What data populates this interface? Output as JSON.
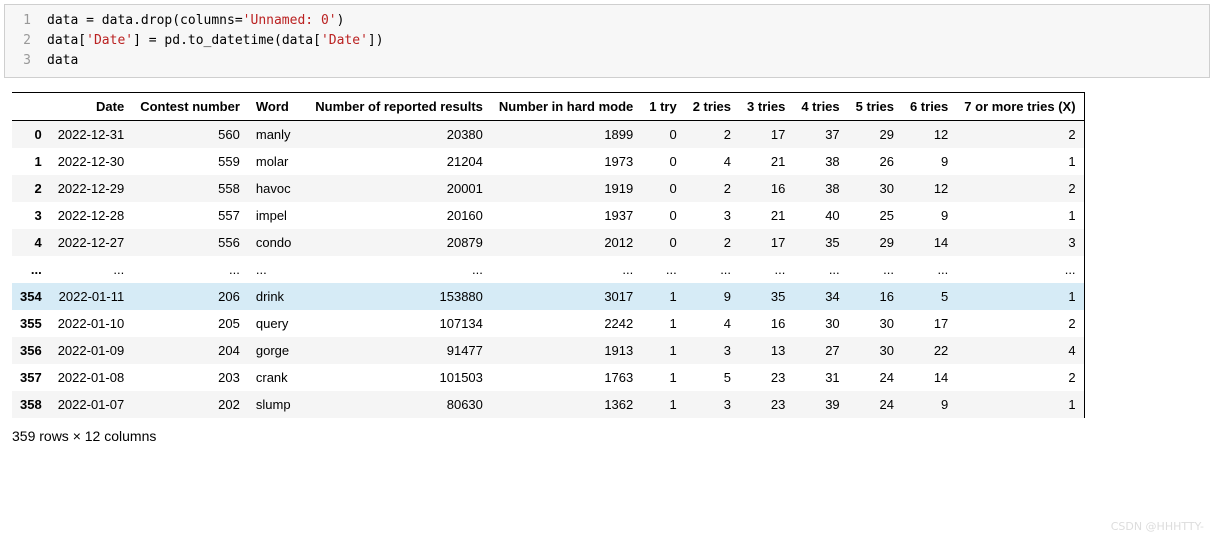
{
  "code": {
    "lines": [
      {
        "n": "1",
        "html": "data = data.drop(columns=<span class=\"tok-str\">'Unnamed: 0'</span>)"
      },
      {
        "n": "2",
        "html": "data[<span class=\"tok-str\">'Date'</span>] = pd.to_datetime(data[<span class=\"tok-str\">'Date'</span>])"
      },
      {
        "n": "3",
        "html": "data"
      }
    ]
  },
  "table": {
    "columns": [
      "",
      "Date",
      "Contest number",
      "Word",
      "Number of reported results",
      "Number in hard mode",
      "1 try",
      "2 tries",
      "3 tries",
      "4 tries",
      "5 tries",
      "6 tries",
      "7 or more tries (X)"
    ],
    "rows": [
      {
        "idx": "0",
        "date": "2022-12-31",
        "contest": "560",
        "word": "manly",
        "reported": "20380",
        "hard": "1899",
        "t1": "0",
        "t2": "2",
        "t3": "17",
        "t4": "37",
        "t5": "29",
        "t6": "12",
        "tx": "2"
      },
      {
        "idx": "1",
        "date": "2022-12-30",
        "contest": "559",
        "word": "molar",
        "reported": "21204",
        "hard": "1973",
        "t1": "0",
        "t2": "4",
        "t3": "21",
        "t4": "38",
        "t5": "26",
        "t6": "9",
        "tx": "1"
      },
      {
        "idx": "2",
        "date": "2022-12-29",
        "contest": "558",
        "word": "havoc",
        "reported": "20001",
        "hard": "1919",
        "t1": "0",
        "t2": "2",
        "t3": "16",
        "t4": "38",
        "t5": "30",
        "t6": "12",
        "tx": "2"
      },
      {
        "idx": "3",
        "date": "2022-12-28",
        "contest": "557",
        "word": "impel",
        "reported": "20160",
        "hard": "1937",
        "t1": "0",
        "t2": "3",
        "t3": "21",
        "t4": "40",
        "t5": "25",
        "t6": "9",
        "tx": "1"
      },
      {
        "idx": "4",
        "date": "2022-12-27",
        "contest": "556",
        "word": "condo",
        "reported": "20879",
        "hard": "2012",
        "t1": "0",
        "t2": "2",
        "t3": "17",
        "t4": "35",
        "t5": "29",
        "t6": "14",
        "tx": "3"
      },
      {
        "idx": "...",
        "date": "...",
        "contest": "...",
        "word": "...",
        "reported": "...",
        "hard": "...",
        "t1": "...",
        "t2": "...",
        "t3": "...",
        "t4": "...",
        "t5": "...",
        "t6": "...",
        "tx": "...",
        "ellipsis": true
      },
      {
        "idx": "354",
        "date": "2022-01-11",
        "contest": "206",
        "word": "drink",
        "reported": "153880",
        "hard": "3017",
        "t1": "1",
        "t2": "9",
        "t3": "35",
        "t4": "34",
        "t5": "16",
        "t6": "5",
        "tx": "1",
        "hover": true
      },
      {
        "idx": "355",
        "date": "2022-01-10",
        "contest": "205",
        "word": "query",
        "reported": "107134",
        "hard": "2242",
        "t1": "1",
        "t2": "4",
        "t3": "16",
        "t4": "30",
        "t5": "30",
        "t6": "17",
        "tx": "2"
      },
      {
        "idx": "356",
        "date": "2022-01-09",
        "contest": "204",
        "word": "gorge",
        "reported": "91477",
        "hard": "1913",
        "t1": "1",
        "t2": "3",
        "t3": "13",
        "t4": "27",
        "t5": "30",
        "t6": "22",
        "tx": "4"
      },
      {
        "idx": "357",
        "date": "2022-01-08",
        "contest": "203",
        "word": "crank",
        "reported": "101503",
        "hard": "1763",
        "t1": "1",
        "t2": "5",
        "t3": "23",
        "t4": "31",
        "t5": "24",
        "t6": "14",
        "tx": "2"
      },
      {
        "idx": "358",
        "date": "2022-01-07",
        "contest": "202",
        "word": "slump",
        "reported": "80630",
        "hard": "1362",
        "t1": "1",
        "t2": "3",
        "t3": "23",
        "t4": "39",
        "t5": "24",
        "t6": "9",
        "tx": "1"
      }
    ],
    "shape_text": "359 rows × 12 columns"
  },
  "watermark": "CSDN @HHHTTY-"
}
